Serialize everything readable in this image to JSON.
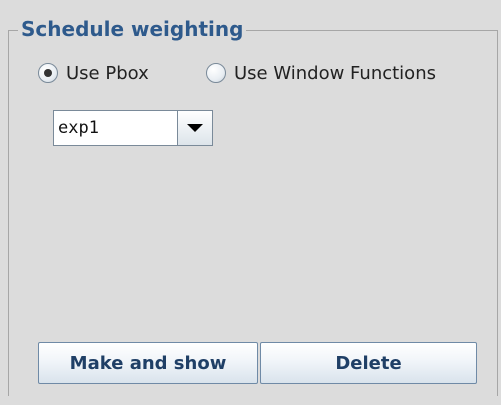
{
  "group": {
    "title": "Schedule weighting"
  },
  "radios": [
    {
      "label": "Use Pbox",
      "checked": true
    },
    {
      "label": "Use Window Functions",
      "checked": false
    }
  ],
  "combo": {
    "value": "exp1"
  },
  "buttons": {
    "make_label": "Make and show",
    "delete_label": "Delete"
  },
  "colors": {
    "panel_bg": "#dcdcdc",
    "title_color": "#2e5a8c",
    "button_text": "#1f3f66"
  }
}
